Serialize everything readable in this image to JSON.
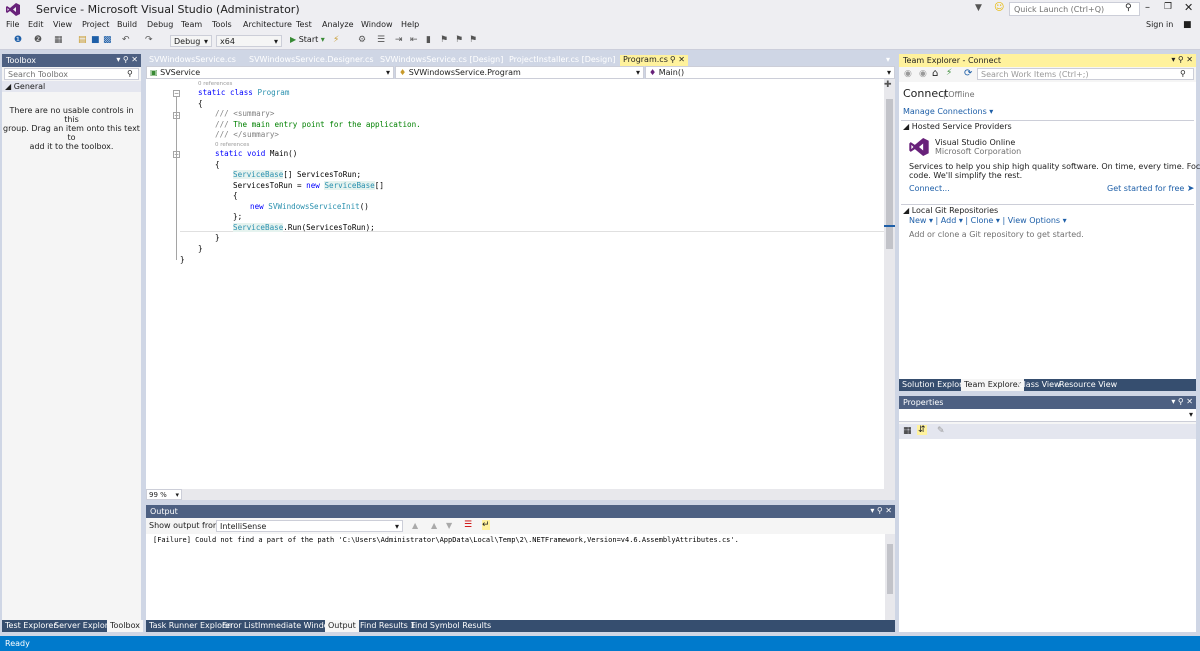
{
  "window": {
    "title": "Service - Microsoft Visual Studio (Administrator)",
    "quick_launch_placeholder": "Quick Launch (Ctrl+Q)",
    "sign_in": "Sign in"
  },
  "menu": [
    "File",
    "Edit",
    "View",
    "Project",
    "Build",
    "Debug",
    "Team",
    "Tools",
    "Architecture",
    "Test",
    "Analyze",
    "Window",
    "Help"
  ],
  "toolbar": {
    "config": "Debug",
    "platform": "x64",
    "start_label": "Start"
  },
  "toolbox": {
    "title": "Toolbox",
    "search_placeholder": "Search Toolbox",
    "group": "General",
    "empty_message_1": "There are no usable controls in this",
    "empty_message_2": "group. Drag an item onto this text to",
    "empty_message_3": "add it to the toolbox.",
    "bottom_tabs": [
      "Test Explorer",
      "Server Explorer",
      "Toolbox"
    ]
  },
  "editor": {
    "tabs": [
      "SVWindowsService.cs",
      "SVWindowsService.Designer.cs",
      "SVWindowsService.cs [Design]",
      "ProjectInstaller.cs [Design]",
      "Program.cs"
    ],
    "nav_project": "SVService",
    "nav_class": "SVWindowsService.Program",
    "nav_member": "Main()",
    "zoom": "99 %",
    "refs": "0 references",
    "code": {
      "l1_kw": "static class ",
      "l1_ty": "Program",
      "brace_open": "{",
      "brace_close": "}",
      "l3": "/// <summary>",
      "l4_a": "/// ",
      "l4_b": "The main entry point for the application.",
      "l5": "/// </summary>",
      "l6_kw": "static void ",
      "l6_rest": "Main()",
      "l8_ty": "ServiceBase",
      "l8_rest": "[] ServicesToRun;",
      "l9_a": "ServicesToRun = ",
      "l9_kw": "new ",
      "l9_ty": "ServiceBase",
      "l9_rest": "[]",
      "l11_kw": "new ",
      "l11_ty": "SVWindowsServiceInit",
      "l11_rest": "()",
      "l12": "};",
      "l13_ty": "ServiceBase",
      "l13_rest": ".Run(ServicesToRun);"
    }
  },
  "team_explorer": {
    "title": "Team Explorer - Connect",
    "search_placeholder": "Search Work Items (Ctrl+;)",
    "connect": "Connect",
    "offline": "Offline",
    "manage_connections": "Manage Connections",
    "hosted_header": "Hosted Service Providers",
    "vso_name": "Visual Studio Online",
    "vso_company": "Microsoft Corporation",
    "vso_desc_1": "Services to help you ship high quality software. On time, every time. Focus on your",
    "vso_desc_2": "code. We'll simplify the rest.",
    "connect_link": "Connect...",
    "get_started": "Get started for free",
    "git_header": "Local Git Repositories",
    "git_new": "New",
    "git_add": "Add",
    "git_clone": "Clone",
    "git_view_options": "View Options",
    "git_hint": "Add or clone a Git repository to get started.",
    "bottom_tabs": [
      "Solution Explorer",
      "Team Explorer",
      "Class View",
      "Resource View"
    ]
  },
  "properties": {
    "title": "Properties"
  },
  "output": {
    "title": "Output",
    "show_from_label": "Show output from:",
    "source": "IntelliSense",
    "message": "[Failure] Could not find a part of the path 'C:\\Users\\Administrator\\AppData\\Local\\Temp\\2\\.NETFramework,Version=v4.6.AssemblyAttributes.cs'.",
    "bottom_tabs": [
      "Task Runner Explorer",
      "Error List",
      "Immediate Window",
      "Output",
      "Find Results 1",
      "Find Symbol Results"
    ]
  },
  "status": {
    "text": "Ready"
  },
  "colors": {
    "accent": "#007acc",
    "panel_title": "#4d6082",
    "active_title": "#fff29d",
    "chrome": "#eeeef2"
  }
}
